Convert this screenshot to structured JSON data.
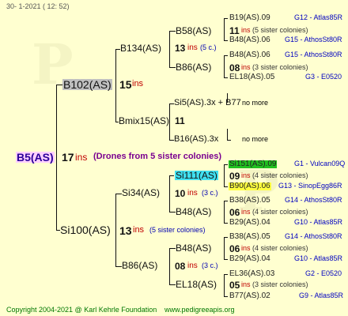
{
  "header": {
    "text": "30-   1-2021  ( 12: 52)"
  },
  "footer": {
    "copyright": "Copyright 2004-2021 @ Karl Kehrle Foundation",
    "site": "www.pedigreeapis.org"
  },
  "root": {
    "name": "B5(AS)",
    "num": "17",
    "ins": "ins",
    "note": "(Drones from 5 sister colonies)"
  },
  "gen1": [
    {
      "name": "B102(AS)",
      "num": "15",
      "ins": "ins"
    },
    {
      "name": "Si100(AS)",
      "num": "13",
      "ins": "ins",
      "note": "(5 sister colonies)"
    }
  ],
  "gen2": [
    {
      "name": "B134(AS)",
      "num": "13",
      "ins": "ins",
      "note": "(5 c.)"
    },
    {
      "name": "Bmix15(AS)",
      "num": "11"
    },
    {
      "name": "Si34(AS)",
      "num": "10",
      "ins": "ins",
      "note": "(3 c.)"
    },
    {
      "name": "B86(AS)",
      "num": "08",
      "ins": "ins",
      "note": "(3 c.)"
    }
  ],
  "gen3": [
    {
      "name": "B58(AS)",
      "num": "11",
      "ins": "ins",
      "note": "(5 sister colonies)"
    },
    {
      "name": "B86(AS)",
      "num": "08",
      "ins": "ins",
      "note": "(3 sister colonies)"
    },
    {
      "name": "Si5(AS).3x + B77",
      "extra": "no more"
    },
    {
      "name": "B16(AS).3x",
      "extra": "no more"
    },
    {
      "name": "Si111(AS)",
      "num": "09",
      "ins": "ins",
      "note": "(4 sister colonies)"
    },
    {
      "name": "B48(AS)",
      "num": "06",
      "ins": "ins",
      "note": "(4 sister colonies)"
    },
    {
      "name": "B48(AS)",
      "num": "06",
      "ins": "ins",
      "note": "(4 sister colonies)"
    },
    {
      "name": "EL18(AS)",
      "num": "05",
      "ins": "ins",
      "note": "(3 sister colonies)"
    }
  ],
  "gen4": [
    {
      "name": "B19(AS).09",
      "code": "G12 - Atlas85R"
    },
    {
      "name": "B48(AS).06",
      "code": "G15 - AthosSt80R"
    },
    {
      "name": "B48(AS).06",
      "code": "G15 - AthosSt80R"
    },
    {
      "name": "EL18(AS).05",
      "code": "G3 - E0520"
    },
    {
      "name": "Si151(AS).09",
      "code": "G1 - Vulcan09Q"
    },
    {
      "name": "B90(AS).06",
      "code": "G13 - SinopEgg86R"
    },
    {
      "name": "B38(AS).05",
      "code": "G14 - AthosSt80R"
    },
    {
      "name": "B29(AS).04",
      "code": "G10 - Atlas85R"
    },
    {
      "name": "B38(AS).05",
      "code": "G14 - AthosSt80R"
    },
    {
      "name": "B29(AS).04",
      "code": "G10 - Atlas85R"
    },
    {
      "name": "EL36(AS).03",
      "code": "G2 - E0520"
    },
    {
      "name": "B77(AS).02",
      "code": "G9 - Atlas85R"
    }
  ]
}
